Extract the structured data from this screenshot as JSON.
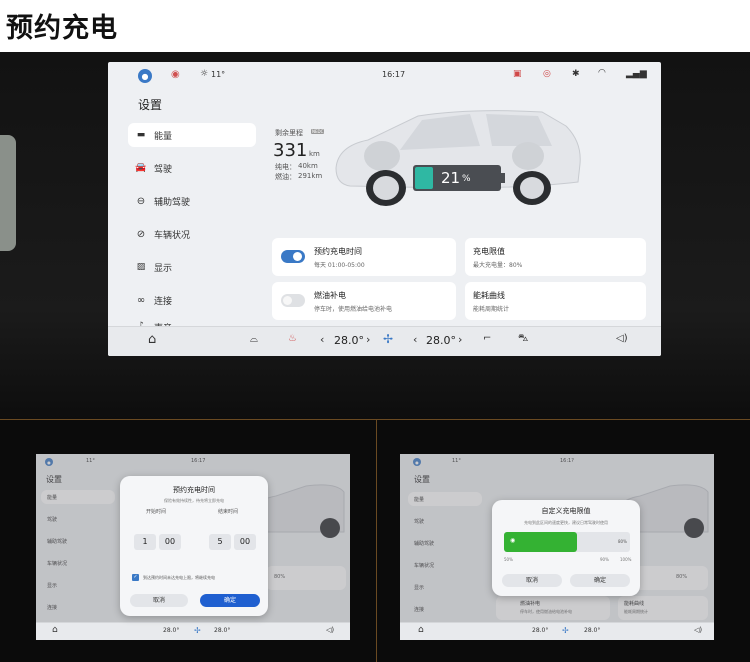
{
  "banner": {
    "title": "预约充电"
  },
  "status": {
    "weather": "11°",
    "time": "16:17",
    "time_small_right": "16:1?"
  },
  "main": {
    "settings_title": "设置",
    "nav": [
      {
        "label": "能量"
      },
      {
        "label": "驾驶"
      },
      {
        "label": "辅助驾驶"
      },
      {
        "label": "车辆状况"
      },
      {
        "label": "显示"
      },
      {
        "label": "连接"
      },
      {
        "label": "声音"
      }
    ],
    "range": {
      "label": "剩余里程",
      "badge": "NEDC",
      "value": "331",
      "unit": "km",
      "ev_label": "纯电：",
      "ev_value": "40km",
      "fuel_label": "燃油：",
      "fuel_value": "291km"
    },
    "battery_percent": "21",
    "battery_unit": "%",
    "battery_level": 0.21,
    "cards": [
      {
        "title": "预约充电时间",
        "sub": "每天 01:00-05:00",
        "toggle": "on"
      },
      {
        "title": "充电限值",
        "sub": "最大充电量：80%"
      },
      {
        "title": "燃油补电",
        "sub": "停车时，使用燃油给电池补电",
        "toggle": "off"
      },
      {
        "title": "能耗曲线",
        "sub": "能耗周期统计"
      }
    ]
  },
  "climate": {
    "left_temp": "28.0°",
    "right_temp": "28.0°"
  },
  "left_shot": {
    "dialog_title": "预约充电时间",
    "dialog_desc": "保险有效持续性，待充将立即充电",
    "start_label": "开始时间",
    "end_label": "结束时间",
    "start_hour": "1",
    "start_min": "00",
    "end_hour": "5",
    "end_min": "00",
    "check_text": "到达预约时间未达充电上限，将继续充电",
    "cancel": "取消",
    "confirm": "确定",
    "settings_title": "设置",
    "nav": [
      "能量",
      "驾驶",
      "辅助驾驶",
      "车辆状况",
      "显示",
      "连接"
    ],
    "partial": "80%",
    "temp_l": "28.0°",
    "temp_r": "28.0°"
  },
  "right_shot": {
    "dialog_title": "自定义充电限值",
    "dialog_desc": "充电到此区间的速度更快，建议日常驾驶时使用",
    "slider_value": "80%",
    "slider_fraction": 0.8,
    "ticks": [
      "50%",
      "90%",
      "100%"
    ],
    "cancel": "取消",
    "confirm": "确定",
    "settings_title": "设置",
    "nav": [
      "能量",
      "驾驶",
      "辅助驾驶",
      "车辆状况",
      "显示",
      "连接"
    ],
    "card_fuel_title": "燃油补电",
    "card_fuel_sub": "停车时，使用燃油给电池补电",
    "card_curve_title": "能耗曲线",
    "card_curve_sub": "能耗周期统计",
    "partial": "80%",
    "temp_l": "28.0°",
    "temp_r": "28.0°"
  }
}
